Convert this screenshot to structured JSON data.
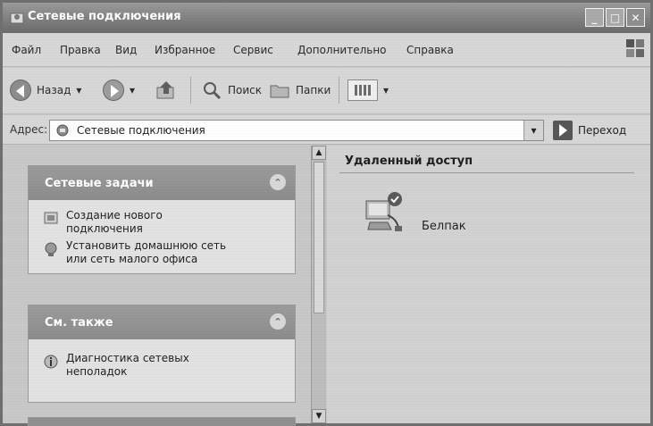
{
  "window": {
    "title": "Сетевые подключения",
    "controls": {
      "minimize": "_",
      "maximize": "□",
      "close": "✕"
    }
  },
  "menu": {
    "items": [
      "Файл",
      "Правка",
      "Вид",
      "Избранное",
      "Сервис",
      "Дополнительно",
      "Справка"
    ]
  },
  "toolbar": {
    "back_label": "Назад",
    "search_label": "Поиск",
    "folders_label": "Папки"
  },
  "address": {
    "label": "Адрес:",
    "value": "Сетевые подключения",
    "go_label": "Переход"
  },
  "tasks_panel": {
    "title": "Сетевые задачи",
    "items": [
      {
        "label_line1": "Создание нового",
        "label_line2": "подключения",
        "icon": "new-connection-icon"
      },
      {
        "label_line1": "Установить домашнюю сеть",
        "label_line2": "или сеть малого офиса",
        "icon": "home-network-icon"
      }
    ]
  },
  "see_also_panel": {
    "title": "См. также",
    "items": [
      {
        "label_line1": "Диагностика сетевых",
        "label_line2": "неполадок",
        "icon": "info-icon"
      }
    ]
  },
  "content": {
    "group_title": "Удаленный доступ",
    "connections": [
      {
        "name": "Белпак",
        "icon": "dialup-connection-icon"
      }
    ]
  }
}
